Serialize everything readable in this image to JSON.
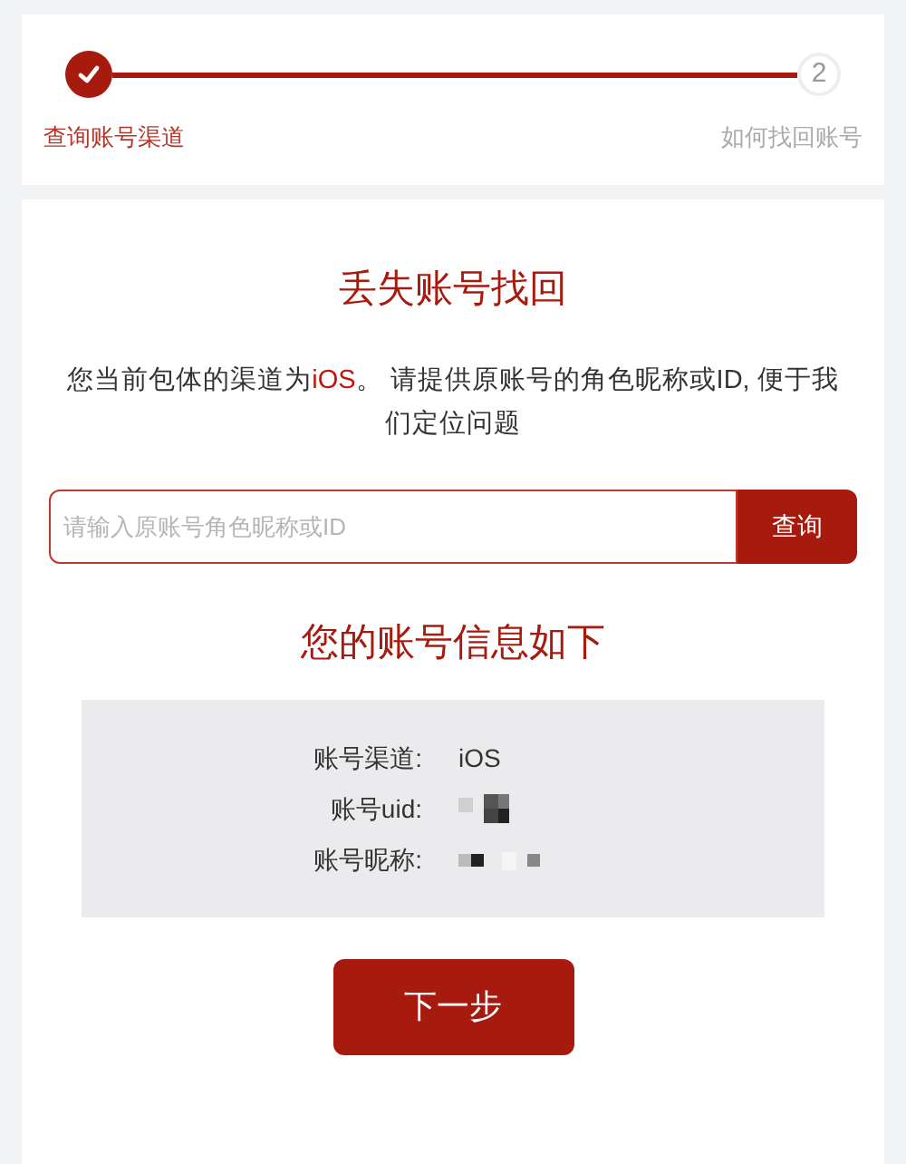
{
  "steps": [
    {
      "label": "查询账号渠道",
      "completed": true
    },
    {
      "label": "如何找回账号",
      "completed": false,
      "number": "2"
    }
  ],
  "title": "丢失账号找回",
  "description": {
    "before": "您当前包体的渠道为",
    "channel": "iOS",
    "after": "。 请提供原账号的角色昵称或ID, 便于我们定位问题"
  },
  "search": {
    "placeholder": "请输入原账号角色昵称或ID",
    "button": "查询"
  },
  "info_title": "您的账号信息如下",
  "info_rows": [
    {
      "label": "账号渠道:",
      "kind": "text",
      "value": "iOS"
    },
    {
      "label": "账号uid:",
      "kind": "redacted"
    },
    {
      "label": "账号昵称:",
      "kind": "redacted"
    }
  ],
  "next_button": "下一步"
}
